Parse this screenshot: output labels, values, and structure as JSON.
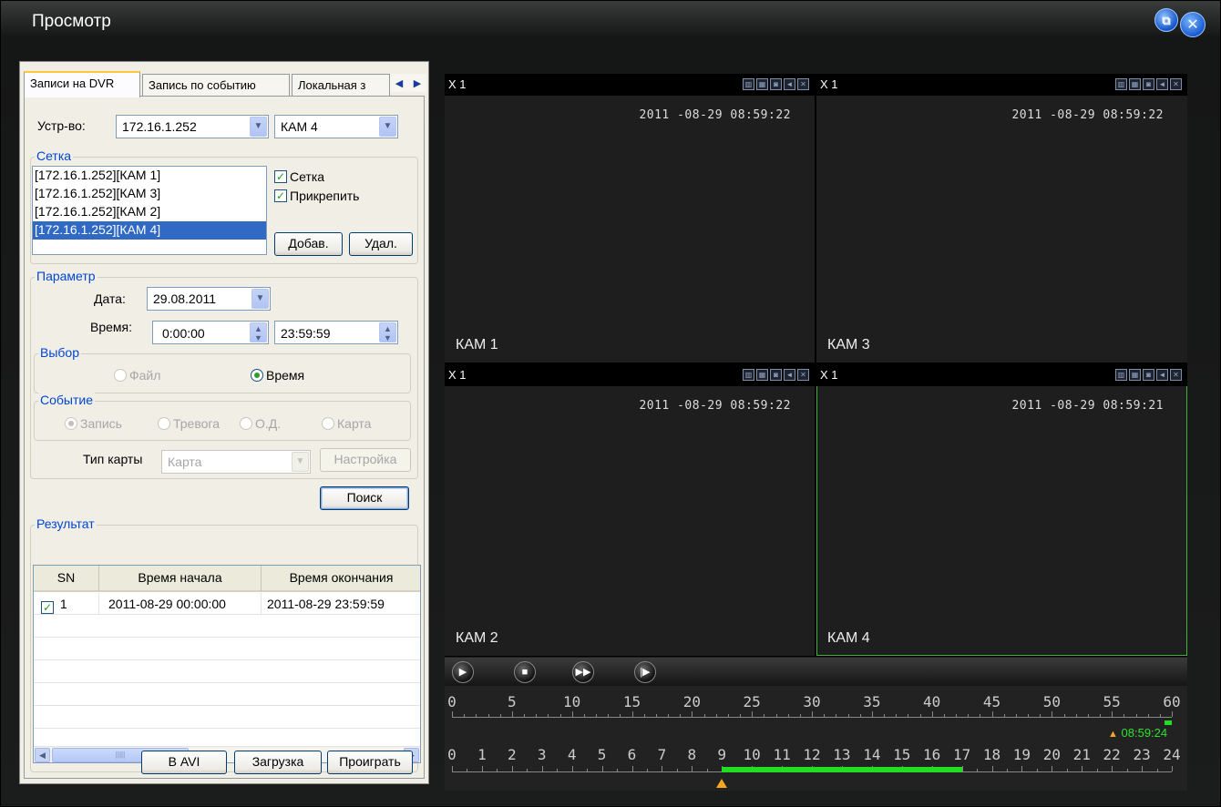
{
  "window": {
    "title": "Просмотр",
    "restore_icon": "restore-icon",
    "close_icon": "close-icon",
    "close_label": "✕"
  },
  "tabs": [
    {
      "label": "Записи на DVR",
      "active": true
    },
    {
      "label": "Запись по событию",
      "active": false
    },
    {
      "label": "Локальная з",
      "active": false
    }
  ],
  "tab_arrows": {
    "left": "◀",
    "right": "▶"
  },
  "device": {
    "label": "Устр-во:",
    "ip_value": "172.16.1.252",
    "cam_value": "КАМ 4"
  },
  "grid": {
    "title": "Сетка",
    "items": [
      {
        "label": "[172.16.1.252][КАМ 1]",
        "selected": false
      },
      {
        "label": "[172.16.1.252][КАМ 3]",
        "selected": false
      },
      {
        "label": "[172.16.1.252][КАМ 2]",
        "selected": false
      },
      {
        "label": "[172.16.1.252][КАМ 4]",
        "selected": true
      }
    ],
    "check_grid": "Сетка",
    "check_attach": "Прикрепить",
    "add_button": "Добав.",
    "delete_button": "Удал."
  },
  "params": {
    "title": "Параметр",
    "date_label": "Дата:",
    "date_value": "29.08.2011",
    "time_label": "Время:",
    "time_from": "0:00:00",
    "time_to": "23:59:59"
  },
  "choice": {
    "title": "Выбор",
    "file": "Файл",
    "time": "Время",
    "selected": "time"
  },
  "event": {
    "title": "Событие",
    "record": "Запись",
    "alarm": "Тревога",
    "motion": "О.Д.",
    "card": "Карта",
    "card_type_label": "Тип карты",
    "card_type_value": "Карта",
    "settings_button": "Настройка"
  },
  "search_button": "Поиск",
  "result": {
    "title": "Результат",
    "columns": [
      "SN",
      "Время начала",
      "Время окончания"
    ],
    "rows": [
      {
        "sn": "1",
        "start": "2011-08-29 00:00:00",
        "end": "2011-08-29 23:59:59",
        "checked": true
      }
    ],
    "scroll_thumb": "|||||"
  },
  "bottom_buttons": {
    "avi": "В AVI",
    "download": "Загрузка",
    "play": "Проиграть"
  },
  "cameras": [
    {
      "zoom": "X 1",
      "timestamp": "2011 -08-29  08:59:22",
      "name": "КАМ 1",
      "active": false
    },
    {
      "zoom": "X 1",
      "timestamp": "2011 -08-29  08:59:22",
      "name": "КАМ 3",
      "active": false
    },
    {
      "zoom": "X 1",
      "timestamp": "2011 -08-29  08:59:22",
      "name": "КАМ 2",
      "active": false
    },
    {
      "zoom": "X 1",
      "timestamp": "2011 -08-29  08:59:21",
      "name": "КАМ 4",
      "active": true
    }
  ],
  "playback": {
    "minute_scale": [
      "0",
      "5",
      "10",
      "15",
      "20",
      "25",
      "30",
      "35",
      "40",
      "45",
      "50",
      "55",
      "60"
    ],
    "hour_scale": [
      "0",
      "1",
      "2",
      "3",
      "4",
      "5",
      "6",
      "7",
      "8",
      "9",
      "10",
      "11",
      "12",
      "13",
      "14",
      "15",
      "16",
      "17",
      "18",
      "19",
      "20",
      "21",
      "22",
      "23",
      "24"
    ],
    "current_time": "08:59:24",
    "minute_position": 59.4,
    "hour_position": 8.99,
    "record_from_hour": 9,
    "record_to_hour": 17
  },
  "colors": {
    "accent": "#316ac5",
    "record": "#22dd22",
    "playhead": "#f5a623",
    "active_cam": "#3fb23f"
  }
}
